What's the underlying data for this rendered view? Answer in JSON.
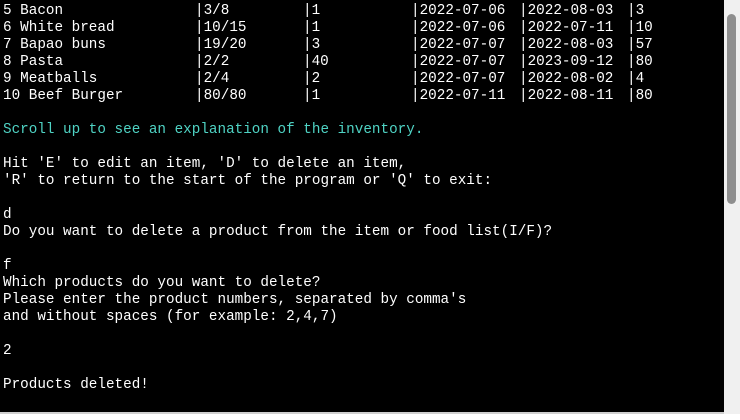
{
  "inventory_rows": [
    {
      "num_name": "5 Bacon",
      "quantity": "|3/8",
      "unit": "|1",
      "purchase_date": "|2022-07-06",
      "expiry_date": "|2022-08-03",
      "days_left": "|3"
    },
    {
      "num_name": "6 White bread",
      "quantity": "|10/15",
      "unit": "|1",
      "purchase_date": "|2022-07-06",
      "expiry_date": "|2022-07-11",
      "days_left": "|10"
    },
    {
      "num_name": "7 Bapao buns",
      "quantity": "|19/20",
      "unit": "|3",
      "purchase_date": "|2022-07-07",
      "expiry_date": "|2022-08-03",
      "days_left": "|57"
    },
    {
      "num_name": "8 Pasta",
      "quantity": "|2/2",
      "unit": "|40",
      "purchase_date": "|2022-07-07",
      "expiry_date": "|2023-09-12",
      "days_left": "|80"
    },
    {
      "num_name": "9 Meatballs",
      "quantity": "|2/4",
      "unit": "|2",
      "purchase_date": "|2022-07-07",
      "expiry_date": "|2022-08-02",
      "days_left": "|4"
    },
    {
      "num_name": "10 Beef Burger",
      "quantity": "|80/80",
      "unit": "|1",
      "purchase_date": "|2022-07-11",
      "expiry_date": "|2022-08-11",
      "days_left": "|80"
    }
  ],
  "output": {
    "scroll_hint": "Scroll up to see an explanation of the inventory.",
    "menu_line_1": "Hit 'E' to edit an item, 'D' to delete an item,",
    "menu_line_2": "'R' to return to the start of the program or 'Q' to exit:",
    "input_1": "d",
    "question_list": "Do you want to delete a product from the item or food list(I/F)?",
    "input_2": "f",
    "question_products": "Which products do you want to delete?",
    "instruction_1": "Please enter the product numbers, separated by comma's",
    "instruction_2": "and without spaces (for example: 2,4,7)",
    "input_3": "2",
    "confirmation": "Products deleted!"
  },
  "colors": {
    "background": "#000000",
    "text": "#ffffff",
    "hint": "#4fd3c4"
  }
}
